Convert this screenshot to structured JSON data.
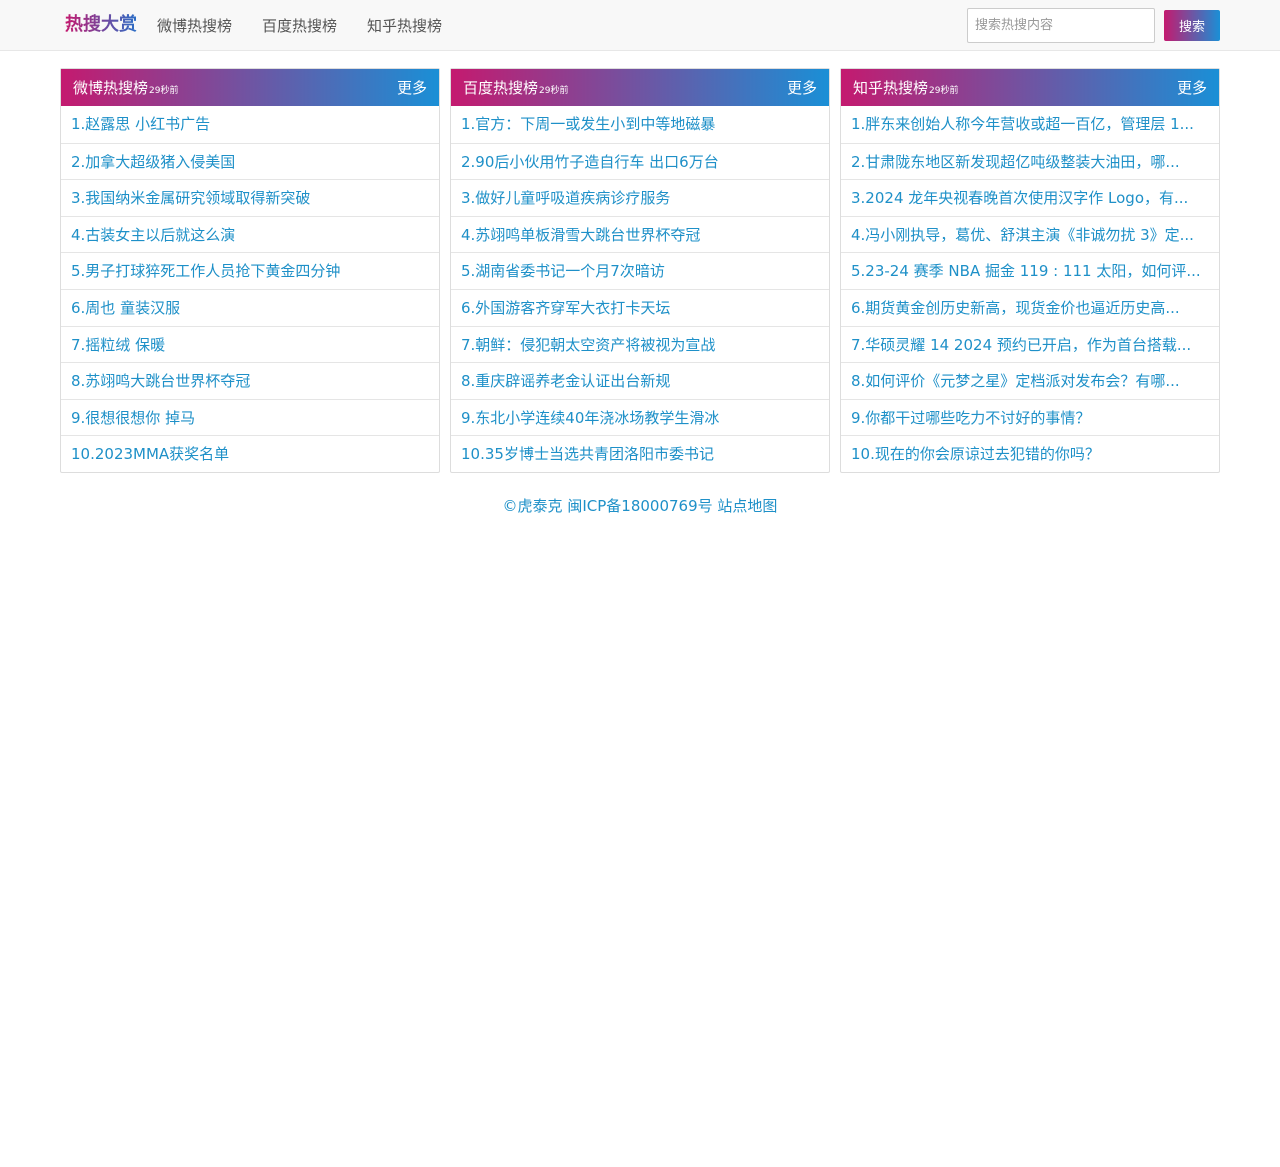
{
  "nav": {
    "brand": "热搜大赏",
    "links": [
      "微博热搜榜",
      "百度热搜榜",
      "知乎热搜榜"
    ],
    "search_placeholder": "搜索热搜内容",
    "search_button": "搜索"
  },
  "colors": {
    "gradient_start": "#c41a6f",
    "gradient_end": "#1a8fd6",
    "link": "#1e90c8"
  },
  "panels": [
    {
      "title": "微博热搜榜",
      "time": "29秒前",
      "more": "更多",
      "items": [
        "1.赵露思 小红书广告",
        "2.加拿大超级猪入侵美国",
        "3.我国纳米金属研究领域取得新突破",
        "4.古装女主以后就这么演",
        "5.男子打球猝死工作人员抢下黄金四分钟",
        "6.周也 童装汉服",
        "7.摇粒绒 保暖",
        "8.苏翊鸣大跳台世界杯夺冠",
        "9.很想很想你 掉马",
        "10.2023MMA获奖名单"
      ]
    },
    {
      "title": "百度热搜榜",
      "time": "29秒前",
      "more": "更多",
      "items": [
        "1.官方：下周一或发生小到中等地磁暴",
        "2.90后小伙用竹子造自行车 出口6万台",
        "3.做好儿童呼吸道疾病诊疗服务",
        "4.苏翊鸣单板滑雪大跳台世界杯夺冠",
        "5.湖南省委书记一个月7次暗访",
        "6.外国游客齐穿军大衣打卡天坛",
        "7.朝鲜：侵犯朝太空资产将被视为宣战",
        "8.重庆辟谣养老金认证出台新规",
        "9.东北小学连续40年浇冰场教学生滑冰",
        "10.35岁博士当选共青团洛阳市委书记"
      ]
    },
    {
      "title": "知乎热搜榜",
      "time": "29秒前",
      "more": "更多",
      "items": [
        "1.胖东来创始人称今年营收或超一百亿，管理层 1...",
        "2.甘肃陇东地区新发现超亿吨级整装大油田，哪...",
        "3.2024 龙年央视春晚首次使用汉字作 Logo，有...",
        "4.冯小刚执导，葛优、舒淇主演《非诚勿扰 3》定...",
        "5.23-24 赛季 NBA 掘金 119 : 111 太阳，如何评...",
        "6.期货黄金创历史新高，现货金价也逼近历史高...",
        "7.华硕灵耀 14 2024 预约已开启，作为首台搭载...",
        "8.如何评价《元梦之星》定档派对发布会？有哪...",
        "9.你都干过哪些吃力不讨好的事情？",
        "10.现在的你会原谅过去犯错的你吗？"
      ]
    }
  ],
  "footer": {
    "copyright": "©虎泰克",
    "icp": "闽ICP备18000769号",
    "sitemap": "站点地图"
  }
}
